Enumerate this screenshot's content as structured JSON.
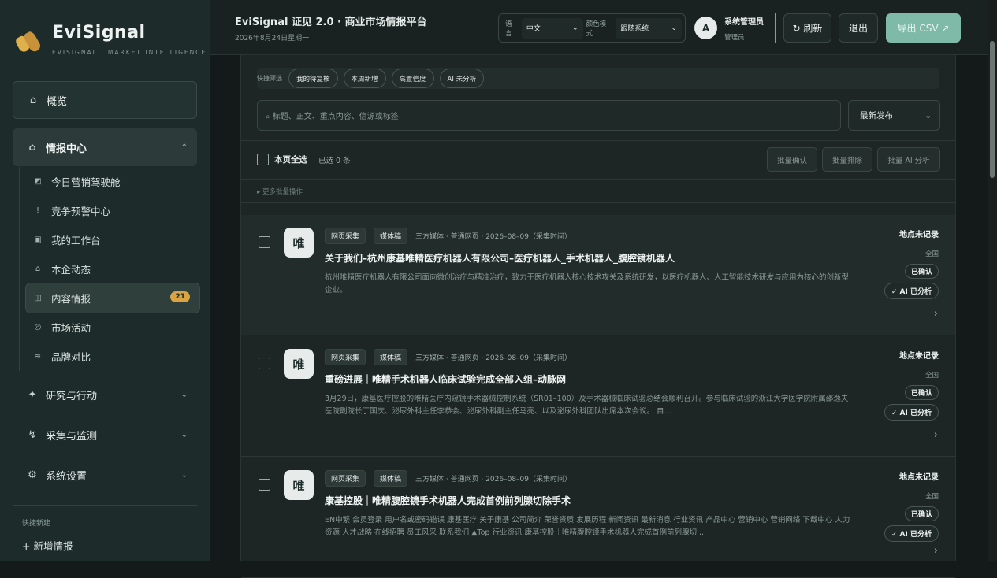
{
  "brand": {
    "name": "EviSignal",
    "subtitle": "EVISIGNAL · MARKET INTELLIGENCE"
  },
  "sidebar": {
    "overview": "概览",
    "intel_center": "情报中心",
    "sub_items": [
      {
        "label": "今日营销驾驶舱",
        "icon": "◩"
      },
      {
        "label": "竞争预警中心",
        "icon": "!"
      },
      {
        "label": "我的工作台",
        "icon": "▣"
      },
      {
        "label": "本企动态",
        "icon": "⌂"
      },
      {
        "label": "内容情报",
        "icon": "◫",
        "badge": "21"
      },
      {
        "label": "市场活动",
        "icon": "◎"
      },
      {
        "label": "品牌对比",
        "icon": "≈"
      }
    ],
    "groups": [
      {
        "label": "研究与行动",
        "icon": "✦"
      },
      {
        "label": "采集与监测",
        "icon": "↯"
      },
      {
        "label": "系统设置",
        "icon": "⚙"
      }
    ],
    "quick_new_label": "快捷新建",
    "quick_new_item": "+ 新增情报"
  },
  "header": {
    "title": "EviSignal 证见 2.0 · 商业市场情报平台",
    "date": "2026年8月24日星期一",
    "lang_label": "语言",
    "lang_value": "中文",
    "color_label": "颜色模式",
    "color_value": "跟随系统",
    "avatar": "A",
    "user_name": "系统管理员",
    "user_role": "管理员",
    "refresh": "↻ 刷新",
    "logout": "退出",
    "export": "导出 CSV ↗"
  },
  "filters": {
    "quick_label": "快捷筛选",
    "chips": [
      "我的待复核",
      "本周新增",
      "高置信度",
      "AI 未分析"
    ],
    "search_placeholder": "⌕ 标题、正文、重点内容、信源或标签",
    "sort_value": "最新发布"
  },
  "bulk": {
    "select_all": "本页全选",
    "selected": "已选 0 条",
    "confirm": "批量确认",
    "exclude": "批量排除",
    "ai": "批量 AI 分析",
    "more": "▸ 更多批量操作"
  },
  "items": [
    {
      "avatar": "唯",
      "tag1": "网页采集",
      "tag2": "媒体稿",
      "meta": "三方媒体 · 普通网页 · 2026–08–09（采集时间）",
      "title": "关于我们–杭州康基唯精医疗机器人有限公司–医疗机器人_手术机器人_腹腔镜机器人",
      "summary": "杭州唯精医疗机器人有限公司面向微创治疗与精准治疗，致力于医疗机器人核心技术攻关及系统研发，以医疗机器人、人工智能技术研发与应用为核心的创新型企业。",
      "location": "地点未记录",
      "region": "全国",
      "status": "已确认",
      "ai": "✓ AI 已分析",
      "arrow": "›"
    },
    {
      "avatar": "唯",
      "tag1": "网页采集",
      "tag2": "媒体稿",
      "meta": "三方媒体 · 普通网页 · 2026–08–09（采集时间）",
      "title": "重磅进展｜唯精手术机器人临床试验完成全部入组–动脉网",
      "summary": "3月29日，康基医疗控股的唯精医疗内窥镜手术器械控制系统（SR01–100）及手术器械临床试验总结会顺利召开。参与临床试验的浙江大学医学院附属邵逸夫医院副院长丁国庆、泌尿外科主任李恭会、泌尿外科副主任马亮、以及泌尿外科团队出席本次会议。 自...",
      "location": "地点未记录",
      "region": "全国",
      "status": "已确认",
      "ai": "✓ AI 已分析",
      "arrow": "›"
    },
    {
      "avatar": "唯",
      "tag1": "网页采集",
      "tag2": "媒体稿",
      "meta": "三方媒体 · 普通网页 · 2026–08–09（采集时间）",
      "title": "康基控股｜唯精腹腔镜手术机器人完成首例前列腺切除手术",
      "summary": "EN中繁 会员登录 用户名或密码错误 康基医疗 关于康基 公司简介 荣誉资质 发展历程 新闻资讯 最新消息 行业资讯 产品中心 营销中心 营销网络 下载中心 人力资源 人才战略 在线招聘 员工风采 联系我们 ▲Top 行业资讯 康基控股｜唯精腹腔镜手术机器人完成首例前列腺切...",
      "location": "地点未记录",
      "region": "全国",
      "status": "已确认",
      "ai": "✓ AI 已分析",
      "arrow": "›"
    }
  ]
}
